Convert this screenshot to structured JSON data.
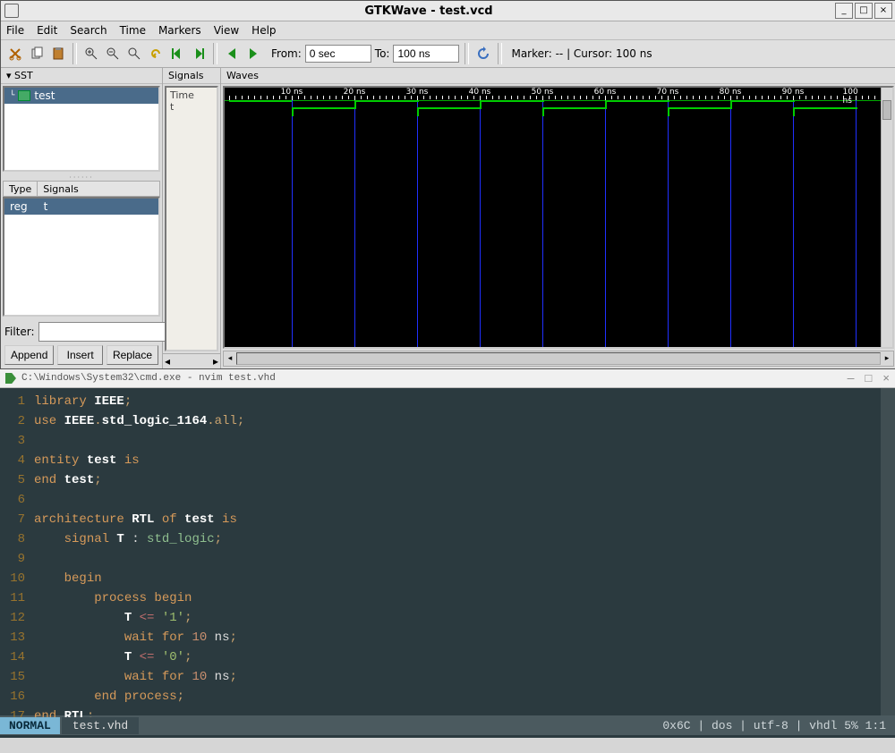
{
  "gtk": {
    "title": "GTKWave - test.vcd",
    "menu": [
      "File",
      "Edit",
      "Search",
      "Time",
      "Markers",
      "View",
      "Help"
    ],
    "from_label": "From:",
    "from_value": "0 sec",
    "to_label": "To:",
    "to_value": "100 ns",
    "status": "Marker: -- | Cursor: 100 ns",
    "sst_label": "SST",
    "tree_item": "test",
    "type_hdr": "Type",
    "signals_hdr": "Signals",
    "sig_type": "reg",
    "sig_name": "t",
    "filter_label": "Filter:",
    "btn_append": "Append",
    "btn_insert": "Insert",
    "btn_replace": "Replace",
    "signals_col": "Signals",
    "waves_col": "Waves",
    "mid_time": "Time",
    "mid_sig": "t",
    "ruler_labels": [
      "10 ns",
      "20 ns",
      "30 ns",
      "40 ns",
      "50 ns",
      "60 ns",
      "70 ns",
      "80 ns",
      "90 ns",
      "100 ns"
    ]
  },
  "nvim": {
    "title": "C:\\Windows\\System32\\cmd.exe - nvim  test.vhd",
    "mode": "NORMAL",
    "filename": "test.vhd",
    "status_right": "0x6C | dos | utf-8 | vhdl    5%    1:1",
    "lines": [
      [
        [
          "kw",
          "library "
        ],
        [
          "id",
          "IEEE"
        ],
        [
          "pn",
          ";"
        ]
      ],
      [
        [
          "kw",
          "use "
        ],
        [
          "id",
          "IEEE"
        ],
        [
          "pn",
          "."
        ],
        [
          "id",
          "std_logic_1164"
        ],
        [
          "pn",
          ".all;"
        ]
      ],
      [],
      [
        [
          "kw",
          "entity "
        ],
        [
          "id",
          "test"
        ],
        [
          "kw",
          " is"
        ]
      ],
      [
        [
          "kw",
          "end "
        ],
        [
          "id",
          "test"
        ],
        [
          "pn",
          ";"
        ]
      ],
      [],
      [
        [
          "kw",
          "architecture "
        ],
        [
          "id",
          "RTL"
        ],
        [
          "kw",
          " of "
        ],
        [
          "id",
          "test"
        ],
        [
          "kw",
          " is"
        ]
      ],
      [
        [
          "",
          "    "
        ],
        [
          "kw",
          "signal "
        ],
        [
          "id",
          "T"
        ],
        [
          "",
          " : "
        ],
        [
          "fn",
          "std_logic"
        ],
        [
          "pn",
          ";"
        ]
      ],
      [],
      [
        [
          "",
          "    "
        ],
        [
          "kw",
          "begin"
        ]
      ],
      [
        [
          "",
          "        "
        ],
        [
          "kw",
          "process begin"
        ]
      ],
      [
        [
          "",
          "            "
        ],
        [
          "id",
          "T"
        ],
        [
          "",
          " "
        ],
        [
          "op",
          "<="
        ],
        [
          "",
          " "
        ],
        [
          "str",
          "'1'"
        ],
        [
          "pn",
          ";"
        ]
      ],
      [
        [
          "",
          "            "
        ],
        [
          "kw",
          "wait for "
        ],
        [
          "num",
          "10"
        ],
        [
          "",
          " ns"
        ],
        [
          "pn",
          ";"
        ]
      ],
      [
        [
          "",
          "            "
        ],
        [
          "id",
          "T"
        ],
        [
          "",
          " "
        ],
        [
          "op",
          "<="
        ],
        [
          "",
          " "
        ],
        [
          "str",
          "'0'"
        ],
        [
          "pn",
          ";"
        ]
      ],
      [
        [
          "",
          "            "
        ],
        [
          "kw",
          "wait for "
        ],
        [
          "num",
          "10"
        ],
        [
          "",
          " ns"
        ],
        [
          "pn",
          ";"
        ]
      ],
      [
        [
          "",
          "        "
        ],
        [
          "kw",
          "end process"
        ],
        [
          "pn",
          ";"
        ]
      ],
      [
        [
          "kw",
          "end "
        ],
        [
          "id",
          "RTL"
        ],
        [
          "pn",
          ";"
        ]
      ]
    ]
  }
}
